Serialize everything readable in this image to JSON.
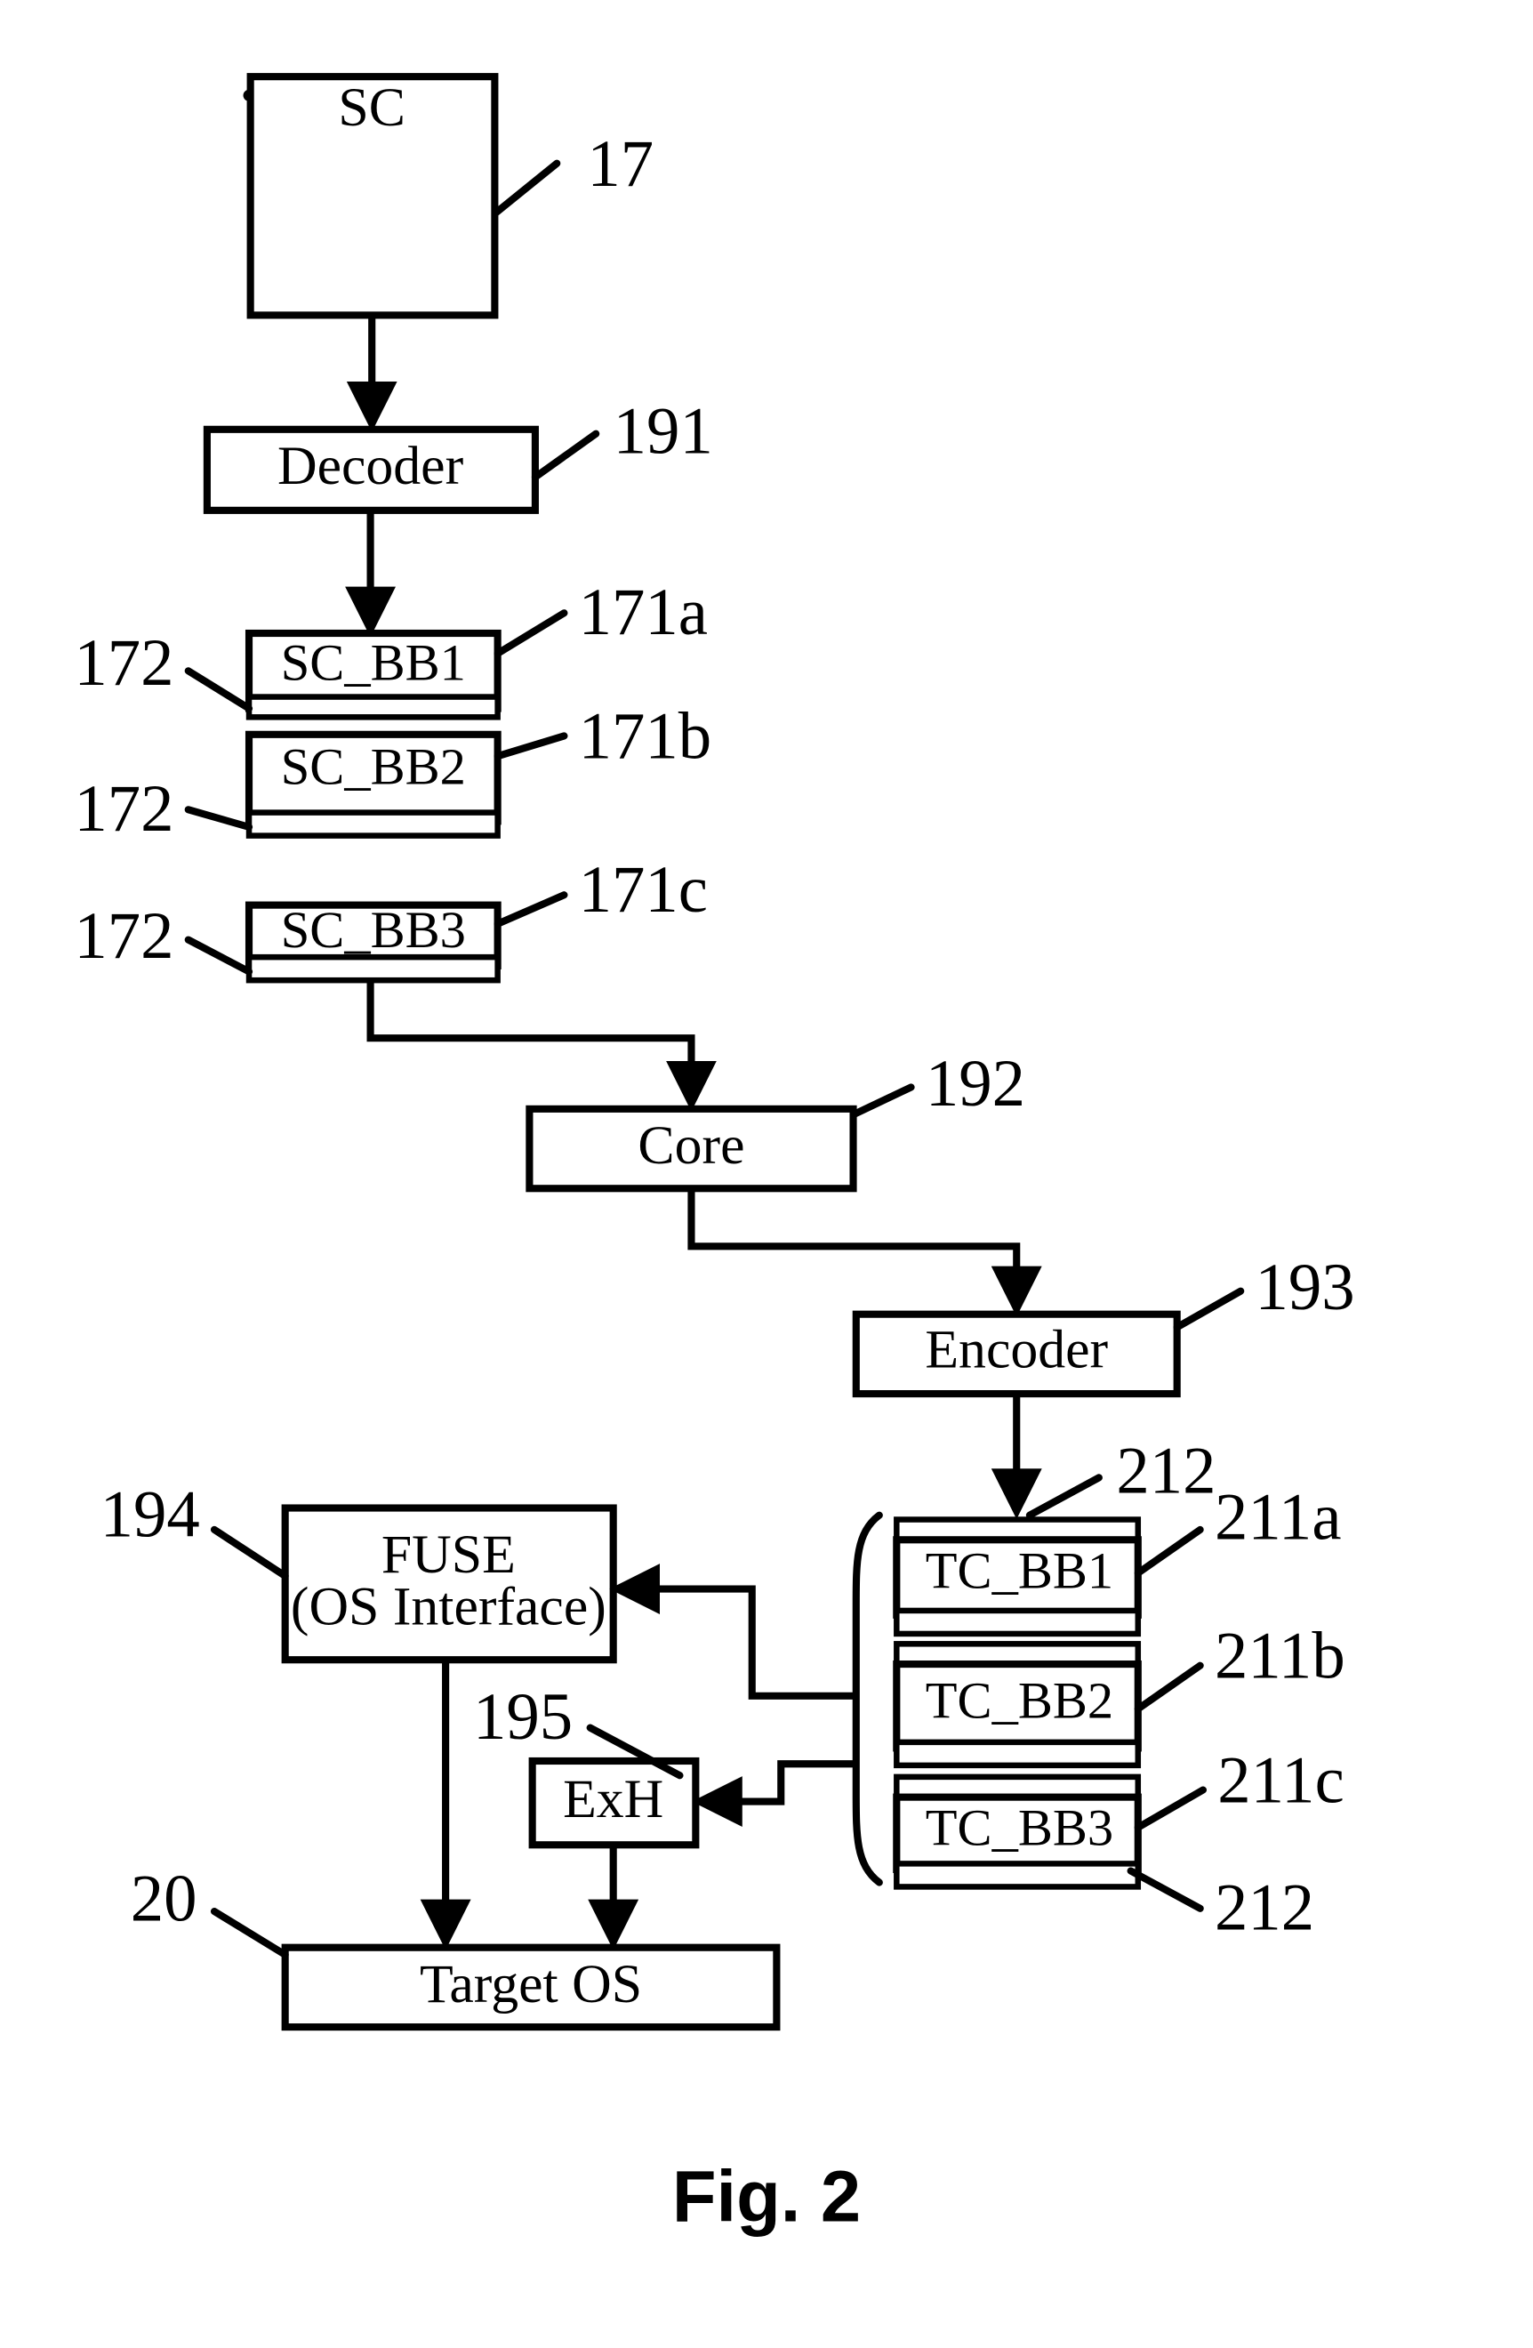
{
  "figure": {
    "caption": "Fig. 2",
    "page_background": "#ffffff",
    "ink_color": "#000000"
  },
  "blocks": {
    "sc": {
      "label": "SC",
      "ref": "17"
    },
    "decoder": {
      "label": "Decoder",
      "ref": "191"
    },
    "sc_bb1": {
      "label": "SC_BB1",
      "ref": "171a",
      "strip_ref": "172"
    },
    "sc_bb2": {
      "label": "SC_BB2",
      "ref": "171b",
      "strip_ref": "172"
    },
    "sc_bb3": {
      "label": "SC_BB3",
      "ref": "171c",
      "strip_ref": "172"
    },
    "core": {
      "label": "Core",
      "ref": "192"
    },
    "encoder": {
      "label": "Encoder",
      "ref": "193"
    },
    "fuse": {
      "label_line1": "FUSE",
      "label_line2": "(OS Interface)",
      "ref": "194"
    },
    "exh": {
      "label": "ExH",
      "ref": "195"
    },
    "target_os": {
      "label": "Target OS",
      "ref": "20"
    },
    "tc_bb1": {
      "label": "TC_BB1",
      "ref": "211a",
      "strip_ref": "212"
    },
    "tc_bb2": {
      "label": "TC_BB2",
      "ref": "211b"
    },
    "tc_bb3": {
      "label": "TC_BB3",
      "ref": "211c",
      "strip_ref": "212"
    }
  },
  "reference_numerals": [
    {
      "id": "r17",
      "text": "17"
    },
    {
      "id": "r191",
      "text": "191"
    },
    {
      "id": "r171a",
      "text": "171a"
    },
    {
      "id": "r171b",
      "text": "171b"
    },
    {
      "id": "r171c",
      "text": "171c"
    },
    {
      "id": "r172a",
      "text": "172"
    },
    {
      "id": "r172b",
      "text": "172"
    },
    {
      "id": "r172c",
      "text": "172"
    },
    {
      "id": "r192",
      "text": "192"
    },
    {
      "id": "r193",
      "text": "193"
    },
    {
      "id": "r194",
      "text": "194"
    },
    {
      "id": "r195",
      "text": "195"
    },
    {
      "id": "r20",
      "text": "20"
    },
    {
      "id": "r212top",
      "text": "212"
    },
    {
      "id": "r211a",
      "text": "211a"
    },
    {
      "id": "r211b",
      "text": "211b"
    },
    {
      "id": "r211c",
      "text": "211c"
    },
    {
      "id": "r212bot",
      "text": "212"
    }
  ],
  "flow": {
    "edges": [
      {
        "from": "sc",
        "to": "decoder"
      },
      {
        "from": "decoder",
        "to": "sc_bb1"
      },
      {
        "from": "sc_bb3",
        "to": "core"
      },
      {
        "from": "core",
        "to": "encoder"
      },
      {
        "from": "encoder",
        "to": "tc_bb1"
      },
      {
        "from": "tc_bb_group",
        "to": "fuse"
      },
      {
        "from": "tc_bb_group",
        "to": "exh"
      },
      {
        "from": "fuse",
        "to": "target_os"
      },
      {
        "from": "exh",
        "to": "target_os"
      }
    ]
  }
}
